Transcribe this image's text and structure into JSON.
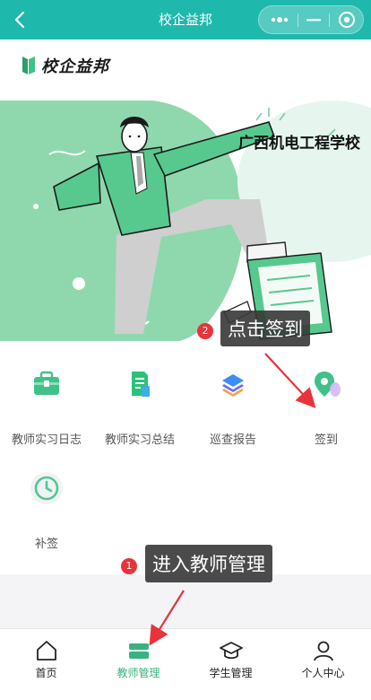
{
  "navbar": {
    "title": "校企益邦",
    "back_icon": "chevron-left-icon",
    "more_icon": "more-dots-icon",
    "minimize_icon": "minimize-icon",
    "close_icon": "target-circle-icon"
  },
  "logo": {
    "text": "校企益邦",
    "icon": "book-logo-icon"
  },
  "banner": {
    "school_name": "广西机电工程学校"
  },
  "functions": [
    {
      "label": "教师实习日志",
      "icon": "briefcase-icon"
    },
    {
      "label": "教师实习总结",
      "icon": "document-icon"
    },
    {
      "label": "巡查报告",
      "icon": "layers-icon"
    },
    {
      "label": "签到",
      "icon": "location-pin-icon"
    },
    {
      "label": "补签",
      "icon": "clock-icon"
    }
  ],
  "tabbar": [
    {
      "label": "首页",
      "icon": "home-icon",
      "active": false
    },
    {
      "label": "教师管理",
      "icon": "stack-icon",
      "active": true
    },
    {
      "label": "学生管理",
      "icon": "graduation-cap-icon",
      "active": false
    },
    {
      "label": "个人中心",
      "icon": "user-icon",
      "active": false
    }
  ],
  "annotations": [
    {
      "number": "2",
      "text": "点击签到"
    },
    {
      "number": "1",
      "text": "进入教师管理"
    }
  ],
  "colors": {
    "navbar": "#1fb8ad",
    "accent_green": "#36b37e",
    "badge_red": "#e8333a"
  }
}
